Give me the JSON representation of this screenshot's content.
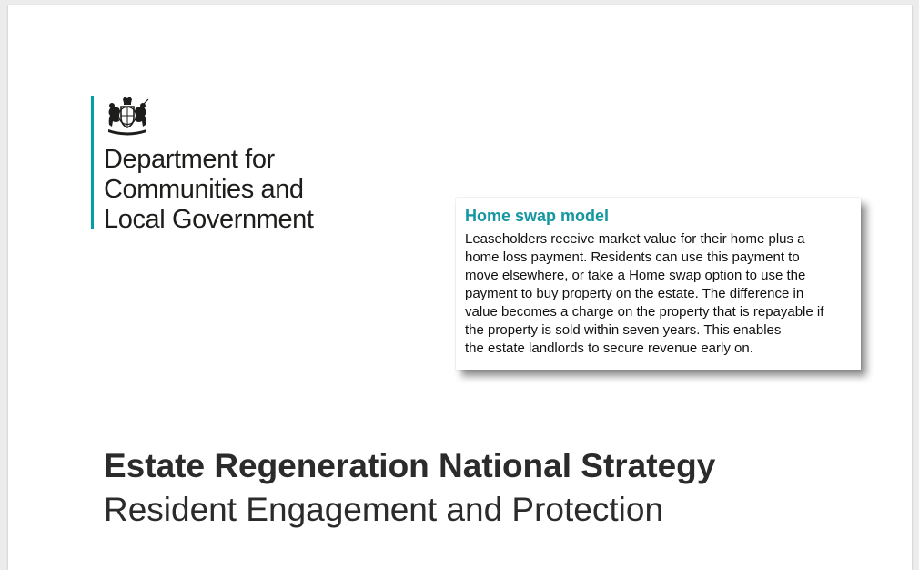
{
  "logo": {
    "crest_icon": "royal-coat-of-arms",
    "accent_color": "#00a0a5",
    "department_lines": [
      "Department for",
      "Communities and",
      "Local Government"
    ]
  },
  "callout": {
    "title": "Home swap model",
    "title_color": "#1497a0",
    "body_lines": [
      "Leaseholders receive market value for their home plus a",
      "home loss payment. Residents can use this payment to",
      "move elsewhere, or take a Home swap option to use the",
      "payment to buy property on the estate. The difference in",
      "value becomes a charge on the property that is repayable if",
      "the property is sold within seven years. This enables",
      "the estate landlords to secure revenue early on."
    ]
  },
  "document": {
    "title": "Estate Regeneration National Strategy",
    "subtitle": "Resident Engagement and Protection"
  }
}
